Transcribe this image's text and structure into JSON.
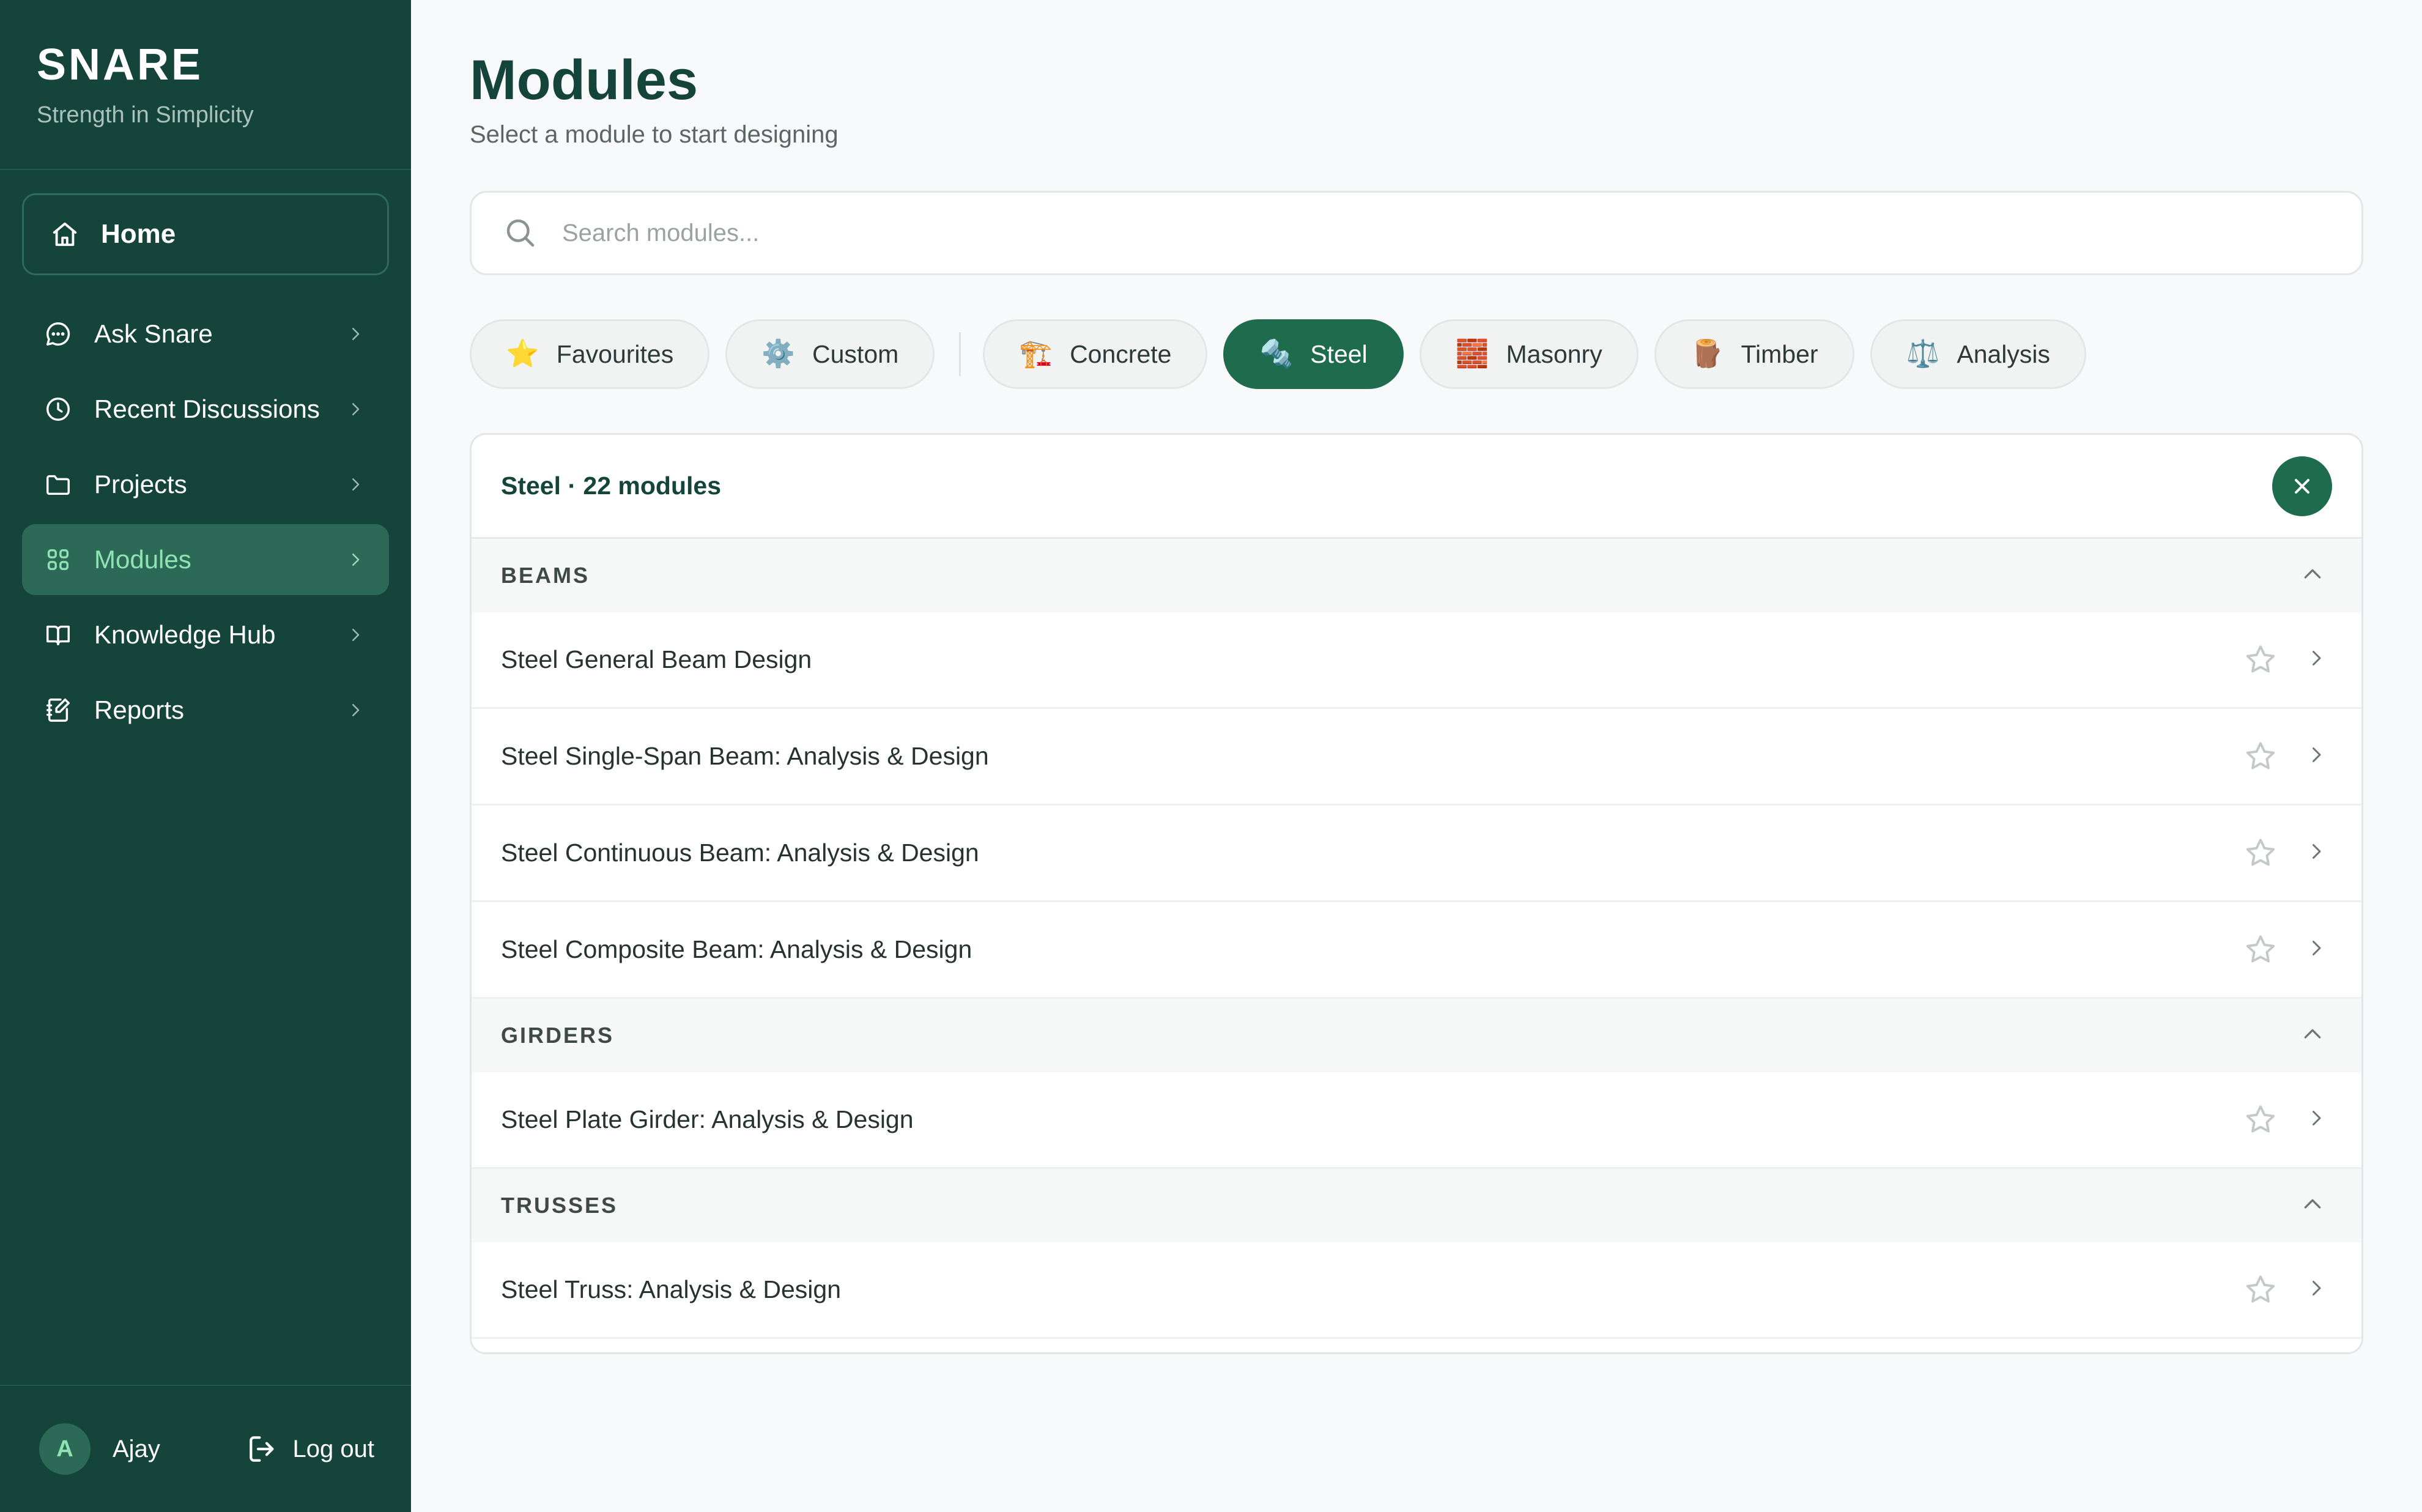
{
  "brand": {
    "title": "SNARE",
    "tagline": "Strength in Simplicity"
  },
  "sidebar": {
    "home": {
      "label": "Home",
      "icon": "home-icon"
    },
    "items": [
      {
        "label": "Ask Snare",
        "icon": "chat-icon",
        "active": false
      },
      {
        "label": "Recent Discussions",
        "icon": "clock-icon",
        "active": false
      },
      {
        "label": "Projects",
        "icon": "folder-icon",
        "active": false
      },
      {
        "label": "Modules",
        "icon": "grid-icon",
        "active": true
      },
      {
        "label": "Knowledge Hub",
        "icon": "book-icon",
        "active": false
      },
      {
        "label": "Reports",
        "icon": "report-icon",
        "active": false
      }
    ]
  },
  "user": {
    "initial": "A",
    "name": "Ajay",
    "logout_label": "Log out"
  },
  "main": {
    "title": "Modules",
    "subtitle": "Select a module to start designing",
    "search": {
      "placeholder": "Search modules...",
      "value": ""
    },
    "filters": [
      {
        "emoji": "⭐",
        "label": "Favourites",
        "active": false
      },
      {
        "emoji": "⚙️",
        "label": "Custom",
        "active": false
      },
      {
        "emoji": "🏗️",
        "label": "Concrete",
        "active": false
      },
      {
        "emoji": "🔩",
        "label": "Steel",
        "active": true
      },
      {
        "emoji": "🧱",
        "label": "Masonry",
        "active": false
      },
      {
        "emoji": "🪵",
        "label": "Timber",
        "active": false
      },
      {
        "emoji": "⚖️",
        "label": "Analysis",
        "active": false
      }
    ],
    "panel": {
      "title": "Steel · 22 modules",
      "groups": [
        {
          "title": "BEAMS",
          "modules": [
            "Steel General Beam Design",
            "Steel Single-Span Beam: Analysis & Design",
            "Steel Continuous Beam: Analysis & Design",
            "Steel Composite Beam: Analysis & Design"
          ]
        },
        {
          "title": "GIRDERS",
          "modules": [
            "Steel Plate Girder: Analysis & Design"
          ]
        },
        {
          "title": "TRUSSES",
          "modules": [
            "Steel Truss: Analysis & Design"
          ]
        }
      ]
    }
  },
  "colors": {
    "sidebar_bg": "#14443a",
    "accent": "#1f6b4d",
    "active_text": "#8fe3b3",
    "page_bg": "#f8f9fa"
  }
}
